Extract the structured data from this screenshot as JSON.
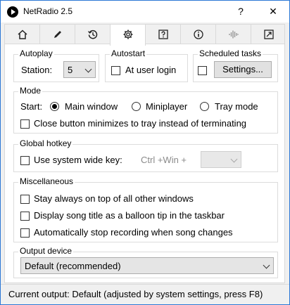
{
  "window": {
    "title": "NetRadio 2.5",
    "help_label": "?",
    "close_label": "✕"
  },
  "tabs": [
    {
      "name": "home-icon"
    },
    {
      "name": "pencil-icon"
    },
    {
      "name": "history-icon"
    },
    {
      "name": "gear-icon",
      "active": true
    },
    {
      "name": "help-box-icon"
    },
    {
      "name": "info-icon"
    },
    {
      "name": "waveform-icon"
    },
    {
      "name": "resize-icon"
    }
  ],
  "autoplay": {
    "title": "Autoplay",
    "station_label": "Station:",
    "station_value": "5"
  },
  "autostart": {
    "title": "Autostart",
    "login_label": "At user login"
  },
  "scheduled": {
    "title": "Scheduled tasks",
    "settings_label": "Settings..."
  },
  "mode": {
    "title": "Mode",
    "start_label": "Start:",
    "options": [
      "Main window",
      "Miniplayer",
      "Tray mode"
    ],
    "selected": "Main window",
    "close_tray_label": "Close button minimizes to tray instead of terminating"
  },
  "hotkey": {
    "title": "Global hotkey",
    "use_label": "Use system wide key:",
    "combo_label": "Ctrl +Win +"
  },
  "misc": {
    "title": "Miscellaneous",
    "items": [
      "Stay always on top of all other windows",
      "Display song title as a balloon tip in the taskbar",
      "Automatically stop recording when song changes"
    ]
  },
  "output": {
    "title": "Output device",
    "device": "Default (recommended)"
  },
  "status": {
    "text": "Current output: Default (adjusted by system settings, press F8)"
  }
}
